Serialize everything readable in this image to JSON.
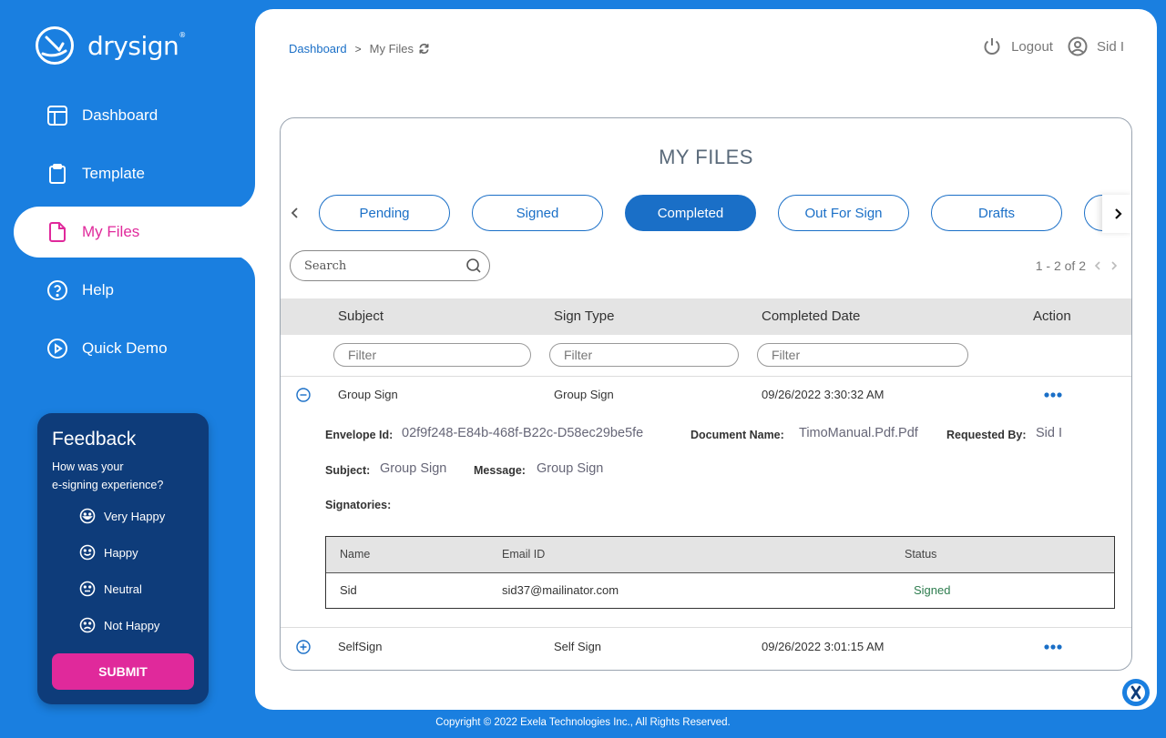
{
  "brand": {
    "name": "drysign",
    "mark": "®"
  },
  "sidebar": {
    "items": [
      {
        "label": "Dashboard",
        "icon": "layout-icon"
      },
      {
        "label": "Template",
        "icon": "clipboard-icon"
      },
      {
        "label": "My Files",
        "icon": "file-icon",
        "active": true
      },
      {
        "label": "Help",
        "icon": "help-icon"
      },
      {
        "label": "Quick Demo",
        "icon": "play-icon"
      }
    ]
  },
  "feedback": {
    "title": "Feedback",
    "subtitle_line1": "How was your",
    "subtitle_line2": "e-signing experience?",
    "options": [
      "Very Happy",
      "Happy",
      "Neutral",
      "Not Happy"
    ],
    "submit_label": "SUBMIT"
  },
  "header": {
    "breadcrumb_root": "Dashboard",
    "breadcrumb_sep": ">",
    "breadcrumb_current": "My Files",
    "logout_label": "Logout",
    "user_name": "Sid I"
  },
  "files": {
    "title": "MY FILES",
    "tabs": [
      "Pending",
      "Signed",
      "Completed",
      "Out For Sign",
      "Drafts"
    ],
    "active_tab": "Completed",
    "search_placeholder": "Search",
    "pager": "1 - 2 of 2",
    "columns": {
      "subject": "Subject",
      "sign_type": "Sign Type",
      "completed_date": "Completed Date",
      "action": "Action"
    },
    "filter_placeholder": "Filter",
    "rows": [
      {
        "subject": "Group Sign",
        "sign_type": "Group Sign",
        "completed_date": "09/26/2022 3:30:32 AM",
        "expanded": true
      },
      {
        "subject": "SelfSign",
        "sign_type": "Self Sign",
        "completed_date": "09/26/2022 3:01:15 AM",
        "expanded": false
      }
    ],
    "detail": {
      "envelope_label": "Envelope Id:",
      "envelope_value": "02f9f248-E84b-468f-B22c-D58ec29be5fe",
      "docname_label": "Document Name:",
      "docname_value": "TimoManual.Pdf.Pdf",
      "requested_label": "Requested By:",
      "requested_value": "Sid I",
      "subject_label": "Subject:",
      "subject_value": "Group Sign",
      "message_label": "Message:",
      "message_value": "Group Sign",
      "signatories_label": "Signatories:",
      "sig_columns": {
        "name": "Name",
        "email": "Email ID",
        "status": "Status"
      },
      "signatories": [
        {
          "name": "Sid",
          "email": "sid37@mailinator.com",
          "status": "Signed"
        }
      ]
    }
  },
  "footer": "Copyright © 2022 Exela Technologies Inc., All Rights Reserved.",
  "colors": {
    "primary": "#1a7fe0",
    "accent": "#e0299b",
    "navy": "#0e3c7a",
    "signed": "#2e7d4f"
  }
}
